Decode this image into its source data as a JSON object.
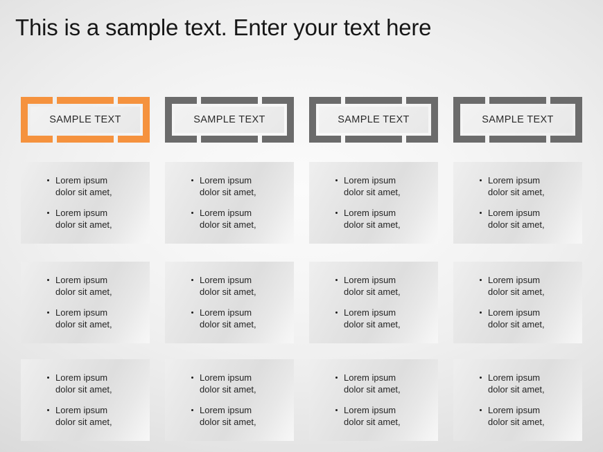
{
  "slide": {
    "title": "This is a sample text. Enter your text here",
    "background_color": "#f4f4f4",
    "accent_color": "#f5923e",
    "neutral_color": "#6b6b6b"
  },
  "columns": [
    {
      "header": "SAMPLE TEXT",
      "accent": true
    },
    {
      "header": "SAMPLE TEXT",
      "accent": false
    },
    {
      "header": "SAMPLE TEXT",
      "accent": false
    },
    {
      "header": "SAMPLE TEXT",
      "accent": false
    }
  ],
  "cards": {
    "bullet_line_1": "Lorem ipsum",
    "bullet_line_2": "dolor sit amet,",
    "rows": [
      {
        "cells": [
          {
            "bullets": [
              {
                "line1": "Lorem ipsum",
                "line2": "dolor sit amet,"
              },
              {
                "line1": "Lorem ipsum",
                "line2": "dolor sit amet,"
              }
            ]
          },
          {
            "bullets": [
              {
                "line1": "Lorem ipsum",
                "line2": "dolor sit amet,"
              },
              {
                "line1": "Lorem ipsum",
                "line2": "dolor sit amet,"
              }
            ]
          },
          {
            "bullets": [
              {
                "line1": "Lorem ipsum",
                "line2": "dolor sit amet,"
              },
              {
                "line1": "Lorem ipsum",
                "line2": "dolor sit amet,"
              }
            ]
          },
          {
            "bullets": [
              {
                "line1": "Lorem ipsum",
                "line2": "dolor sit amet,"
              },
              {
                "line1": "Lorem ipsum",
                "line2": "dolor sit amet,"
              }
            ]
          }
        ]
      },
      {
        "cells": [
          {
            "bullets": [
              {
                "line1": "Lorem ipsum",
                "line2": "dolor sit amet,"
              },
              {
                "line1": "Lorem ipsum",
                "line2": "dolor sit amet,"
              }
            ]
          },
          {
            "bullets": [
              {
                "line1": "Lorem ipsum",
                "line2": "dolor sit amet,"
              },
              {
                "line1": "Lorem ipsum",
                "line2": "dolor sit amet,"
              }
            ]
          },
          {
            "bullets": [
              {
                "line1": "Lorem ipsum",
                "line2": "dolor sit amet,"
              },
              {
                "line1": "Lorem ipsum",
                "line2": "dolor sit amet,"
              }
            ]
          },
          {
            "bullets": [
              {
                "line1": "Lorem ipsum",
                "line2": "dolor sit amet,"
              },
              {
                "line1": "Lorem ipsum",
                "line2": "dolor sit amet,"
              }
            ]
          }
        ]
      },
      {
        "cells": [
          {
            "bullets": [
              {
                "line1": "Lorem ipsum",
                "line2": "dolor sit amet,"
              },
              {
                "line1": "Lorem ipsum",
                "line2": "dolor sit amet,"
              }
            ]
          },
          {
            "bullets": [
              {
                "line1": "Lorem ipsum",
                "line2": "dolor sit amet,"
              },
              {
                "line1": "Lorem ipsum",
                "line2": "dolor sit amet,"
              }
            ]
          },
          {
            "bullets": [
              {
                "line1": "Lorem ipsum",
                "line2": "dolor sit amet,"
              },
              {
                "line1": "Lorem ipsum",
                "line2": "dolor sit amet,"
              }
            ]
          },
          {
            "bullets": [
              {
                "line1": "Lorem ipsum",
                "line2": "dolor sit amet,"
              },
              {
                "line1": "Lorem ipsum",
                "line2": "dolor sit amet,"
              }
            ]
          }
        ]
      }
    ]
  }
}
